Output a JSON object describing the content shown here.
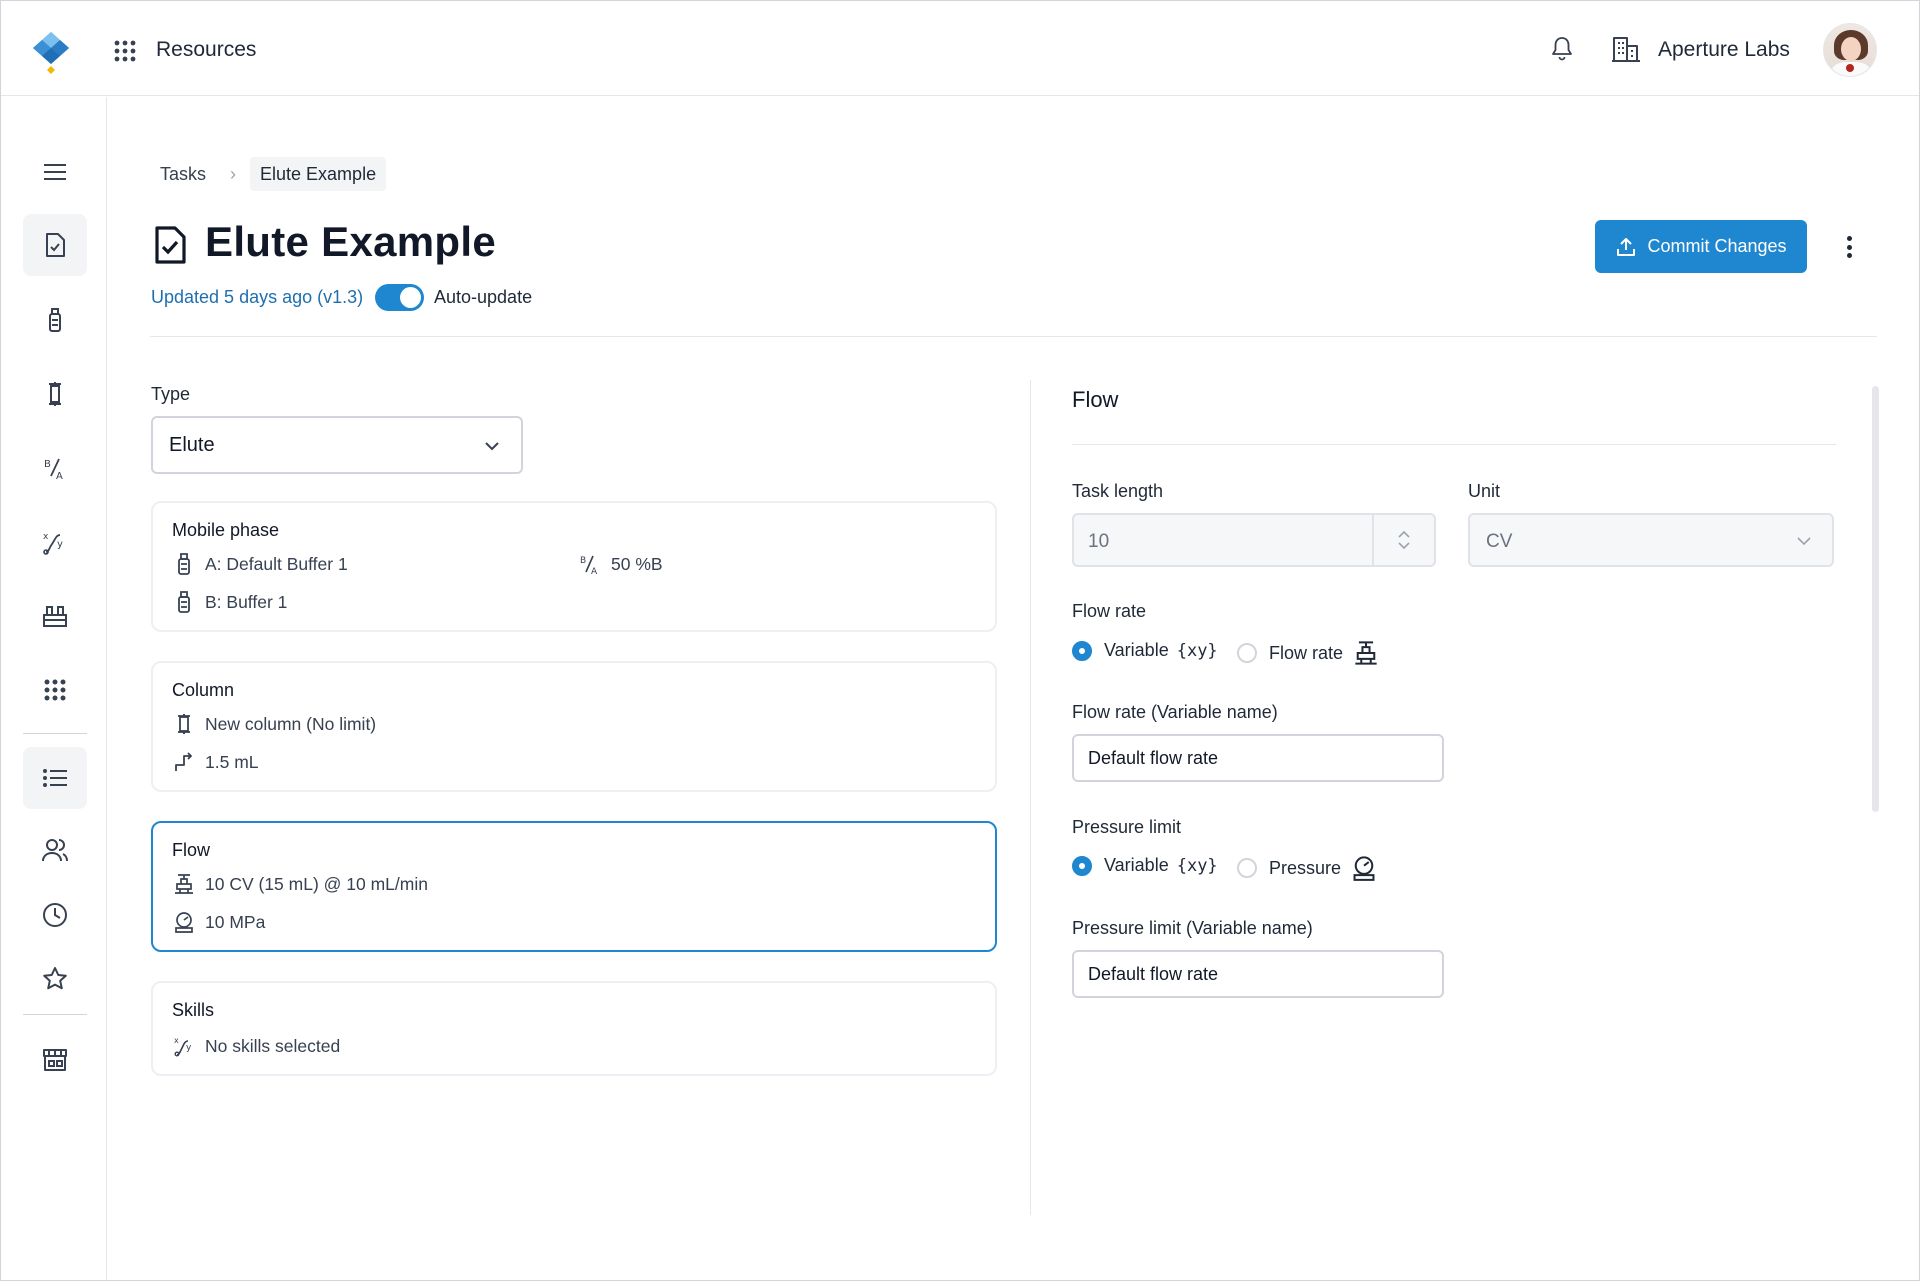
{
  "topbar": {
    "app_menu_label": "Resources",
    "org_name": "Aperture Labs"
  },
  "breadcrumb": {
    "items": [
      "Tasks",
      "Elute Example"
    ]
  },
  "header": {
    "title": "Elute Example",
    "updated": "Updated 5 days ago (v1.3)",
    "auto_update_label": "Auto-update",
    "auto_update_on": true,
    "commit_label": "Commit Changes"
  },
  "left": {
    "type_label": "Type",
    "type_value": "Elute",
    "mobile_phase": {
      "title": "Mobile phase",
      "a": "A: Default Buffer 1",
      "b": "B: Buffer 1",
      "ratio": "50 %B"
    },
    "column": {
      "title": "Column",
      "name": "New column (No limit)",
      "volume": "1.5 mL"
    },
    "flow": {
      "title": "Flow",
      "length": "10 CV (15 mL) @ 10 mL/min",
      "pressure": "10 MPa"
    },
    "skills": {
      "title": "Skills",
      "value": "No skills selected"
    }
  },
  "right": {
    "title": "Flow",
    "task_length_label": "Task length",
    "task_length_value": "10",
    "unit_label": "Unit",
    "unit_value": "CV",
    "flow_rate_label": "Flow rate",
    "flow_rate_options": [
      "Variable",
      "Flow rate"
    ],
    "flow_rate_selected": "Variable",
    "xy_badge": "{xy}",
    "flow_rate_var_label": "Flow rate (Variable name)",
    "flow_rate_var_value": "Default flow rate",
    "pressure_label": "Pressure limit",
    "pressure_options": [
      "Variable",
      "Pressure"
    ],
    "pressure_selected": "Variable",
    "pressure_var_label": "Pressure limit (Variable name)",
    "pressure_var_value": "Default flow rate"
  },
  "colors": {
    "accent": "#1f87cf",
    "link": "#1e6fb0",
    "border": "#d1d5db"
  },
  "icons": {
    "sidebar": [
      "menu-icon",
      "task-document-icon",
      "bottle-icon",
      "column-icon",
      "ratio-icon",
      "skills-icon",
      "rack-icon",
      "grid-icon",
      "list-icon",
      "users-icon",
      "clock-icon",
      "star-icon",
      "store-icon"
    ]
  }
}
